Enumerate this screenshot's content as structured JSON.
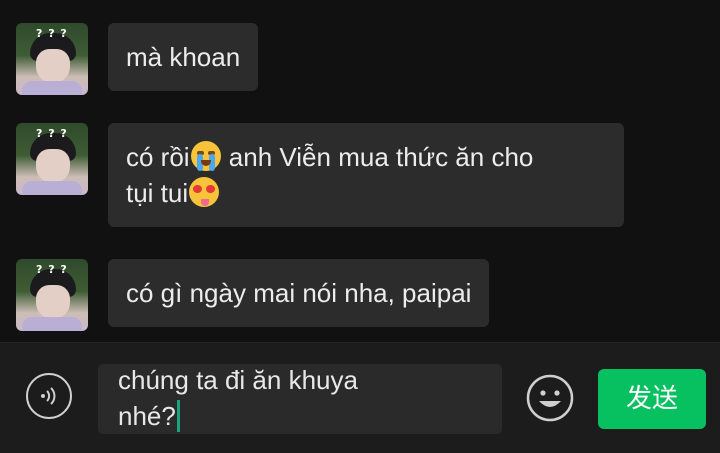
{
  "messages": [
    {
      "text": "mà khoan"
    },
    {
      "text_part1": "có rồi",
      "emoji1": "loudly-crying-face",
      "text_part2": " anh Viễn mua thức ăn cho",
      "text_part3": "tụi tui",
      "emoji2": "heart-eyes-drooling-face"
    },
    {
      "text": "có gì ngày mai nói nha, paipai"
    }
  ],
  "avatar_text": "? ? ?",
  "input": {
    "line1": "chúng ta đi ăn khuya",
    "line2": "nhé?"
  },
  "send_label": "发送",
  "colors": {
    "send": "#07c160",
    "bubble": "#2c2c2c",
    "caret": "#1ca27a"
  }
}
